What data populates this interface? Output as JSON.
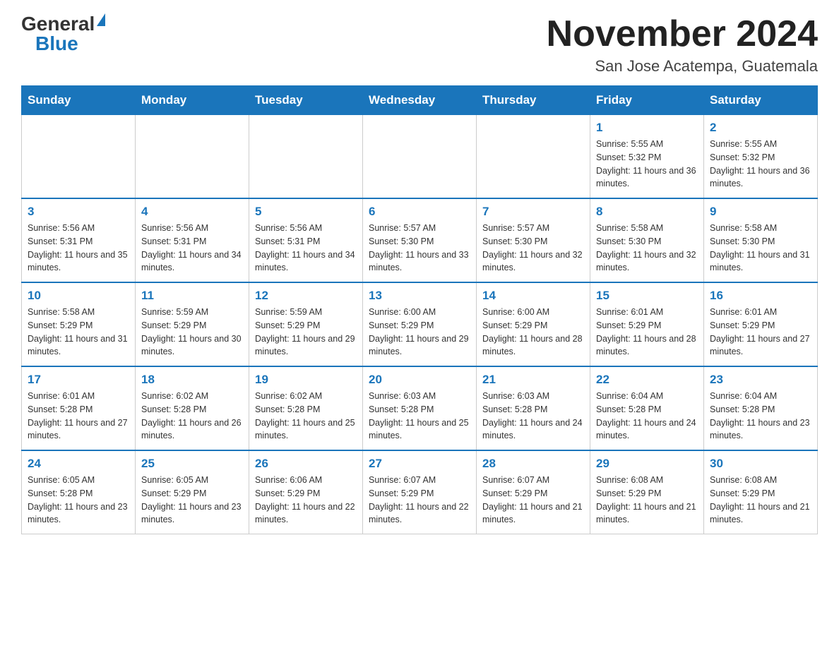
{
  "logo": {
    "general": "General",
    "blue": "Blue"
  },
  "title": "November 2024",
  "location": "San Jose Acatempa, Guatemala",
  "days_of_week": [
    "Sunday",
    "Monday",
    "Tuesday",
    "Wednesday",
    "Thursday",
    "Friday",
    "Saturday"
  ],
  "weeks": [
    [
      {
        "day": "",
        "info": ""
      },
      {
        "day": "",
        "info": ""
      },
      {
        "day": "",
        "info": ""
      },
      {
        "day": "",
        "info": ""
      },
      {
        "day": "",
        "info": ""
      },
      {
        "day": "1",
        "info": "Sunrise: 5:55 AM\nSunset: 5:32 PM\nDaylight: 11 hours and 36 minutes."
      },
      {
        "day": "2",
        "info": "Sunrise: 5:55 AM\nSunset: 5:32 PM\nDaylight: 11 hours and 36 minutes."
      }
    ],
    [
      {
        "day": "3",
        "info": "Sunrise: 5:56 AM\nSunset: 5:31 PM\nDaylight: 11 hours and 35 minutes."
      },
      {
        "day": "4",
        "info": "Sunrise: 5:56 AM\nSunset: 5:31 PM\nDaylight: 11 hours and 34 minutes."
      },
      {
        "day": "5",
        "info": "Sunrise: 5:56 AM\nSunset: 5:31 PM\nDaylight: 11 hours and 34 minutes."
      },
      {
        "day": "6",
        "info": "Sunrise: 5:57 AM\nSunset: 5:30 PM\nDaylight: 11 hours and 33 minutes."
      },
      {
        "day": "7",
        "info": "Sunrise: 5:57 AM\nSunset: 5:30 PM\nDaylight: 11 hours and 32 minutes."
      },
      {
        "day": "8",
        "info": "Sunrise: 5:58 AM\nSunset: 5:30 PM\nDaylight: 11 hours and 32 minutes."
      },
      {
        "day": "9",
        "info": "Sunrise: 5:58 AM\nSunset: 5:30 PM\nDaylight: 11 hours and 31 minutes."
      }
    ],
    [
      {
        "day": "10",
        "info": "Sunrise: 5:58 AM\nSunset: 5:29 PM\nDaylight: 11 hours and 31 minutes."
      },
      {
        "day": "11",
        "info": "Sunrise: 5:59 AM\nSunset: 5:29 PM\nDaylight: 11 hours and 30 minutes."
      },
      {
        "day": "12",
        "info": "Sunrise: 5:59 AM\nSunset: 5:29 PM\nDaylight: 11 hours and 29 minutes."
      },
      {
        "day": "13",
        "info": "Sunrise: 6:00 AM\nSunset: 5:29 PM\nDaylight: 11 hours and 29 minutes."
      },
      {
        "day": "14",
        "info": "Sunrise: 6:00 AM\nSunset: 5:29 PM\nDaylight: 11 hours and 28 minutes."
      },
      {
        "day": "15",
        "info": "Sunrise: 6:01 AM\nSunset: 5:29 PM\nDaylight: 11 hours and 28 minutes."
      },
      {
        "day": "16",
        "info": "Sunrise: 6:01 AM\nSunset: 5:29 PM\nDaylight: 11 hours and 27 minutes."
      }
    ],
    [
      {
        "day": "17",
        "info": "Sunrise: 6:01 AM\nSunset: 5:28 PM\nDaylight: 11 hours and 27 minutes."
      },
      {
        "day": "18",
        "info": "Sunrise: 6:02 AM\nSunset: 5:28 PM\nDaylight: 11 hours and 26 minutes."
      },
      {
        "day": "19",
        "info": "Sunrise: 6:02 AM\nSunset: 5:28 PM\nDaylight: 11 hours and 25 minutes."
      },
      {
        "day": "20",
        "info": "Sunrise: 6:03 AM\nSunset: 5:28 PM\nDaylight: 11 hours and 25 minutes."
      },
      {
        "day": "21",
        "info": "Sunrise: 6:03 AM\nSunset: 5:28 PM\nDaylight: 11 hours and 24 minutes."
      },
      {
        "day": "22",
        "info": "Sunrise: 6:04 AM\nSunset: 5:28 PM\nDaylight: 11 hours and 24 minutes."
      },
      {
        "day": "23",
        "info": "Sunrise: 6:04 AM\nSunset: 5:28 PM\nDaylight: 11 hours and 23 minutes."
      }
    ],
    [
      {
        "day": "24",
        "info": "Sunrise: 6:05 AM\nSunset: 5:28 PM\nDaylight: 11 hours and 23 minutes."
      },
      {
        "day": "25",
        "info": "Sunrise: 6:05 AM\nSunset: 5:29 PM\nDaylight: 11 hours and 23 minutes."
      },
      {
        "day": "26",
        "info": "Sunrise: 6:06 AM\nSunset: 5:29 PM\nDaylight: 11 hours and 22 minutes."
      },
      {
        "day": "27",
        "info": "Sunrise: 6:07 AM\nSunset: 5:29 PM\nDaylight: 11 hours and 22 minutes."
      },
      {
        "day": "28",
        "info": "Sunrise: 6:07 AM\nSunset: 5:29 PM\nDaylight: 11 hours and 21 minutes."
      },
      {
        "day": "29",
        "info": "Sunrise: 6:08 AM\nSunset: 5:29 PM\nDaylight: 11 hours and 21 minutes."
      },
      {
        "day": "30",
        "info": "Sunrise: 6:08 AM\nSunset: 5:29 PM\nDaylight: 11 hours and 21 minutes."
      }
    ]
  ]
}
